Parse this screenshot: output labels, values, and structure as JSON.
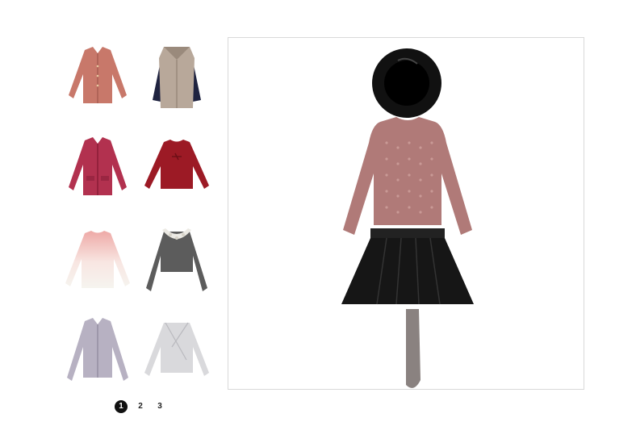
{
  "thumbnails": [
    {
      "name": "pink-cardigan",
      "color": "#c8786a"
    },
    {
      "name": "faux-fur-vest",
      "color": "#b8a89a"
    },
    {
      "name": "magenta-cardigan",
      "color": "#b2314f"
    },
    {
      "name": "red-sweater",
      "color": "#9c1a25"
    },
    {
      "name": "pink-ombre-sweater",
      "color": "#f0c2bd"
    },
    {
      "name": "gray-lace-collar-top",
      "color": "#5c5c5c"
    },
    {
      "name": "lavender-cardigan",
      "color": "#b7b1c2"
    },
    {
      "name": "light-gray-wrap-top",
      "color": "#d9d9dc"
    }
  ],
  "pagination": {
    "pages": [
      "1",
      "2",
      "3"
    ],
    "active": "1"
  },
  "outfit": {
    "hat_color": "#111111",
    "sweater_color": "#b07a78",
    "skirt_color": "#161616",
    "tights_color": "#8a8280"
  }
}
